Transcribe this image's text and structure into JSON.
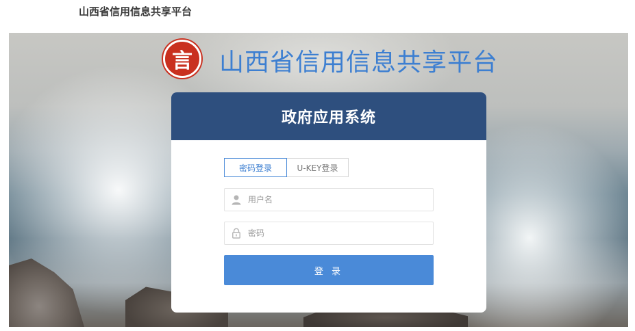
{
  "header": {
    "site_title": "山西省信用信息共享平台"
  },
  "banner": {
    "logo_glyph": "言",
    "title": "山西省信用信息共享平台",
    "title_color": "#3d7fd1"
  },
  "login_card": {
    "header_title": "政府应用系统",
    "header_color": "#2e4f7e",
    "tabs": [
      {
        "label": "密码登录",
        "active": true
      },
      {
        "label": "U-KEY登录",
        "active": false
      }
    ],
    "username": {
      "placeholder": "用户名",
      "icon": "user-icon"
    },
    "password": {
      "placeholder": "密码",
      "icon": "lock-icon"
    },
    "submit_label": "登 录",
    "accent_color": "#4a8ad8"
  }
}
